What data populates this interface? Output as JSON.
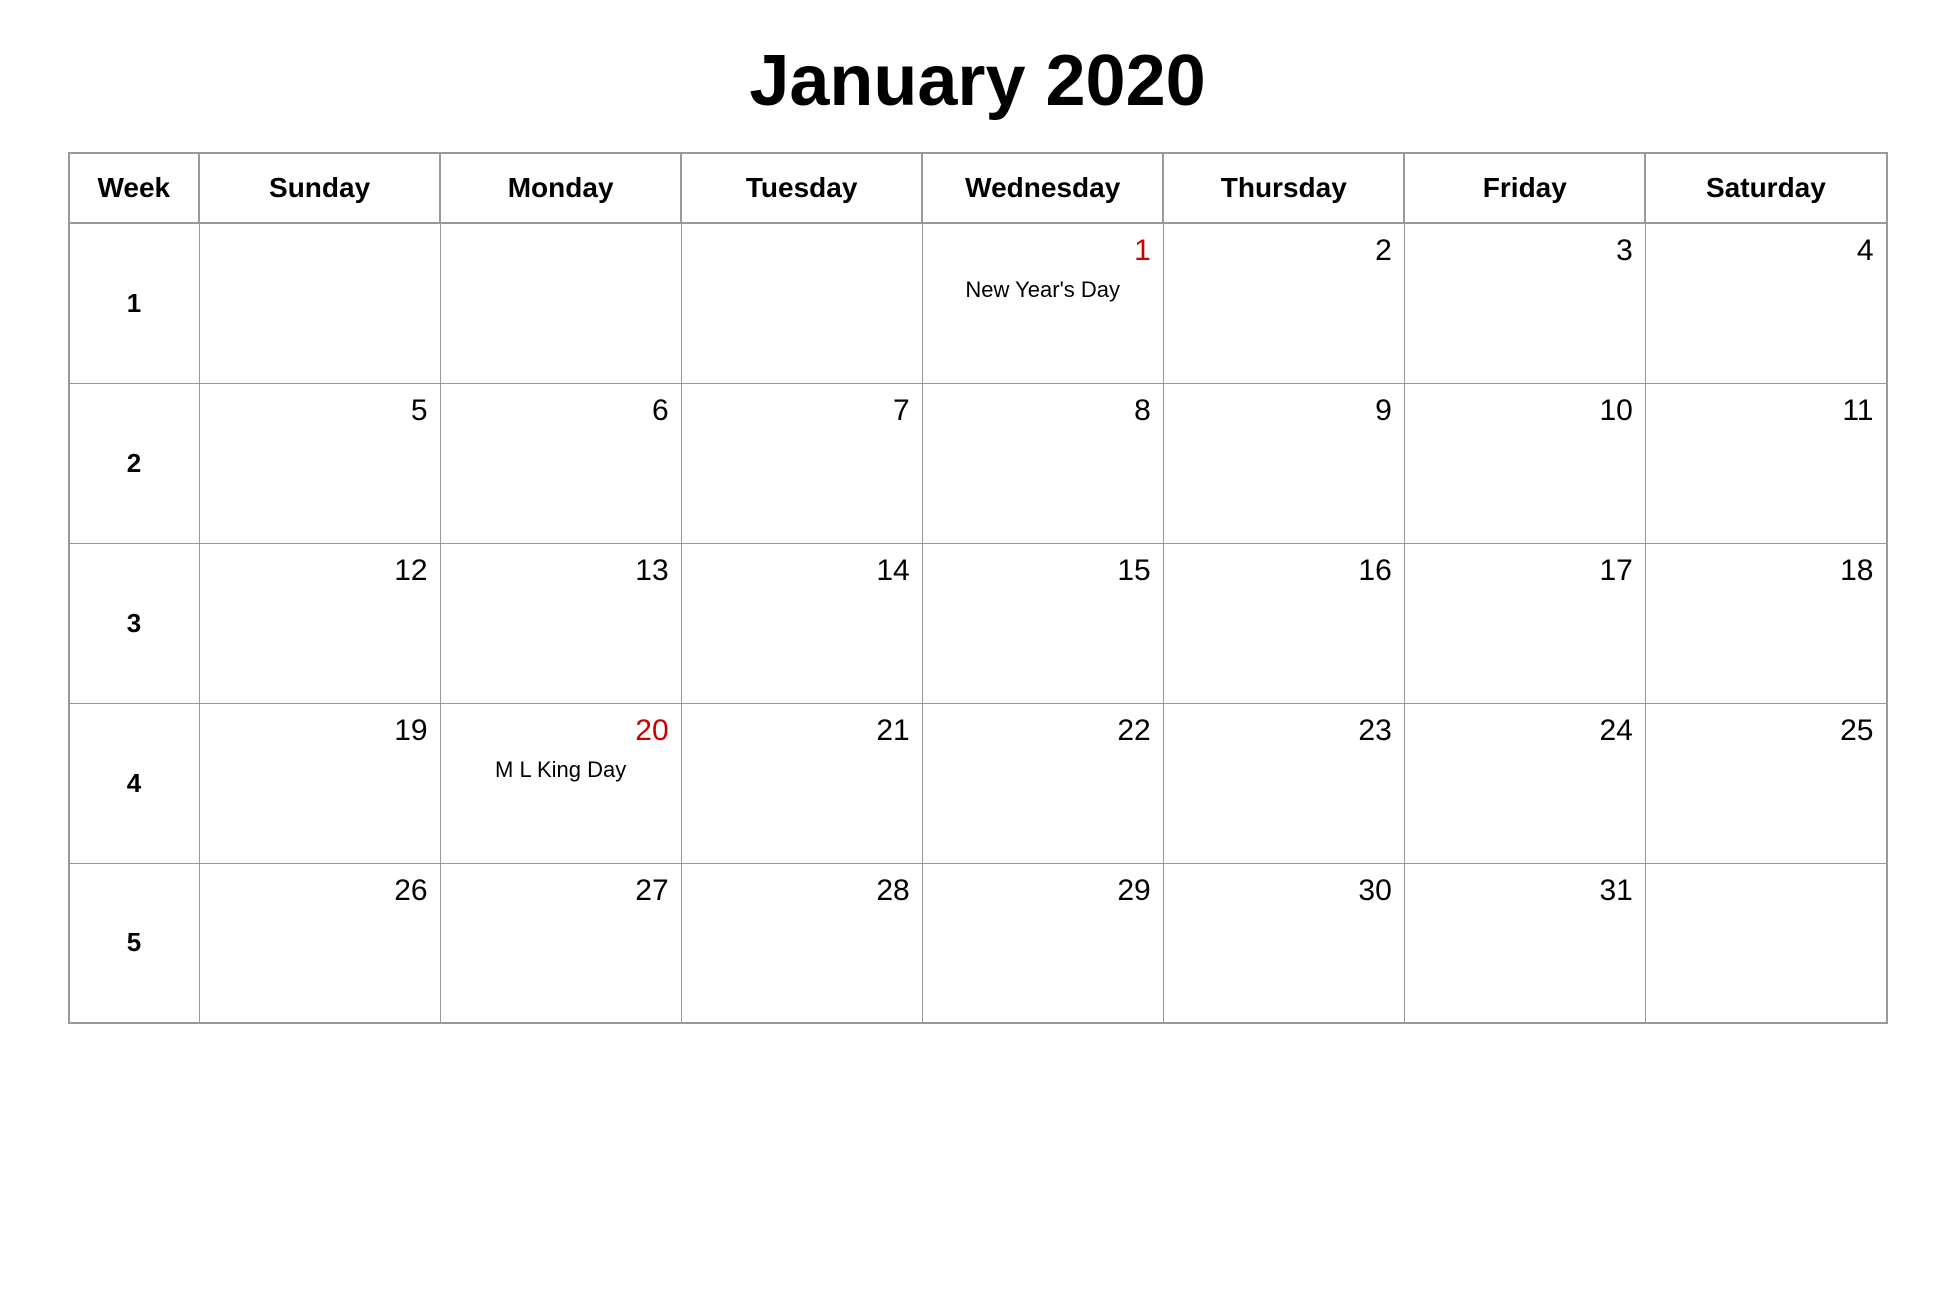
{
  "title": "January 2020",
  "headers": [
    "Week",
    "Sunday",
    "Monday",
    "Tuesday",
    "Wednesday",
    "Thursday",
    "Friday",
    "Saturday"
  ],
  "weeks": [
    {
      "weekNum": "1",
      "days": [
        {
          "date": "",
          "holiday": false,
          "holidayName": ""
        },
        {
          "date": "",
          "holiday": false,
          "holidayName": ""
        },
        {
          "date": "",
          "holiday": false,
          "holidayName": ""
        },
        {
          "date": "1",
          "holiday": true,
          "holidayName": "New  Year's  Day"
        },
        {
          "date": "2",
          "holiday": false,
          "holidayName": ""
        },
        {
          "date": "3",
          "holiday": false,
          "holidayName": ""
        },
        {
          "date": "4",
          "holiday": false,
          "holidayName": ""
        }
      ]
    },
    {
      "weekNum": "2",
      "days": [
        {
          "date": "5",
          "holiday": false,
          "holidayName": ""
        },
        {
          "date": "6",
          "holiday": false,
          "holidayName": ""
        },
        {
          "date": "7",
          "holiday": false,
          "holidayName": ""
        },
        {
          "date": "8",
          "holiday": false,
          "holidayName": ""
        },
        {
          "date": "9",
          "holiday": false,
          "holidayName": ""
        },
        {
          "date": "10",
          "holiday": false,
          "holidayName": ""
        },
        {
          "date": "11",
          "holiday": false,
          "holidayName": ""
        }
      ]
    },
    {
      "weekNum": "3",
      "days": [
        {
          "date": "12",
          "holiday": false,
          "holidayName": ""
        },
        {
          "date": "13",
          "holiday": false,
          "holidayName": ""
        },
        {
          "date": "14",
          "holiday": false,
          "holidayName": ""
        },
        {
          "date": "15",
          "holiday": false,
          "holidayName": ""
        },
        {
          "date": "16",
          "holiday": false,
          "holidayName": ""
        },
        {
          "date": "17",
          "holiday": false,
          "holidayName": ""
        },
        {
          "date": "18",
          "holiday": false,
          "holidayName": ""
        }
      ]
    },
    {
      "weekNum": "4",
      "days": [
        {
          "date": "19",
          "holiday": false,
          "holidayName": ""
        },
        {
          "date": "20",
          "holiday": true,
          "holidayName": "M  L  King  Day"
        },
        {
          "date": "21",
          "holiday": false,
          "holidayName": ""
        },
        {
          "date": "22",
          "holiday": false,
          "holidayName": ""
        },
        {
          "date": "23",
          "holiday": false,
          "holidayName": ""
        },
        {
          "date": "24",
          "holiday": false,
          "holidayName": ""
        },
        {
          "date": "25",
          "holiday": false,
          "holidayName": ""
        }
      ]
    },
    {
      "weekNum": "5",
      "days": [
        {
          "date": "26",
          "holiday": false,
          "holidayName": ""
        },
        {
          "date": "27",
          "holiday": false,
          "holidayName": ""
        },
        {
          "date": "28",
          "holiday": false,
          "holidayName": ""
        },
        {
          "date": "29",
          "holiday": false,
          "holidayName": ""
        },
        {
          "date": "30",
          "holiday": false,
          "holidayName": ""
        },
        {
          "date": "31",
          "holiday": false,
          "holidayName": ""
        },
        {
          "date": "",
          "holiday": false,
          "holidayName": ""
        }
      ]
    }
  ]
}
